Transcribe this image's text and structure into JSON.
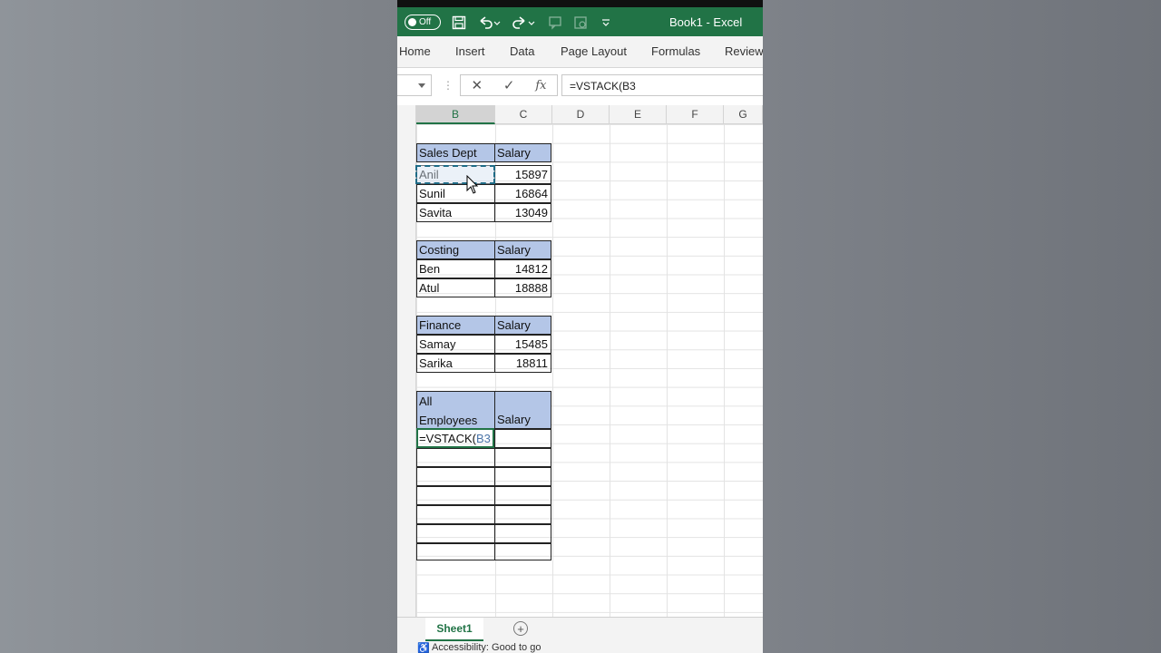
{
  "window": {
    "title": "Book1  -  Excel",
    "autosave_state": "Off"
  },
  "ribbon": {
    "tabs": [
      "Home",
      "Insert",
      "Data",
      "Page Layout",
      "Formulas",
      "Review"
    ]
  },
  "formula_bar": {
    "content": "=VSTACK(B3",
    "fx_label": "fx"
  },
  "columns": [
    "B",
    "C",
    "D",
    "E",
    "F",
    "G"
  ],
  "tables": [
    {
      "header": [
        "Sales Dept",
        "Salary"
      ],
      "rows": [
        [
          "Anil",
          "15897"
        ],
        [
          "Sunil",
          "16864"
        ],
        [
          "Savita",
          "13049"
        ]
      ]
    },
    {
      "header": [
        "Costing",
        "Salary"
      ],
      "rows": [
        [
          "Ben",
          "14812"
        ],
        [
          "Atul",
          "18888"
        ]
      ]
    },
    {
      "header": [
        "Finance",
        "Salary"
      ],
      "rows": [
        [
          "Samay",
          "15485"
        ],
        [
          "Sarika",
          "18811"
        ]
      ]
    }
  ],
  "all_employees": {
    "header_line1": "All",
    "header_line2": "Employees",
    "salary": "Salary",
    "formula_prefix": "=VSTACK(",
    "formula_ref": "B3"
  },
  "sheet_tabs": [
    "Sheet1"
  ],
  "status": {
    "accessibility": "Accessibility: Good to go"
  },
  "colors": {
    "excel_green": "#217346",
    "header_fill": "#b4c6e7"
  }
}
